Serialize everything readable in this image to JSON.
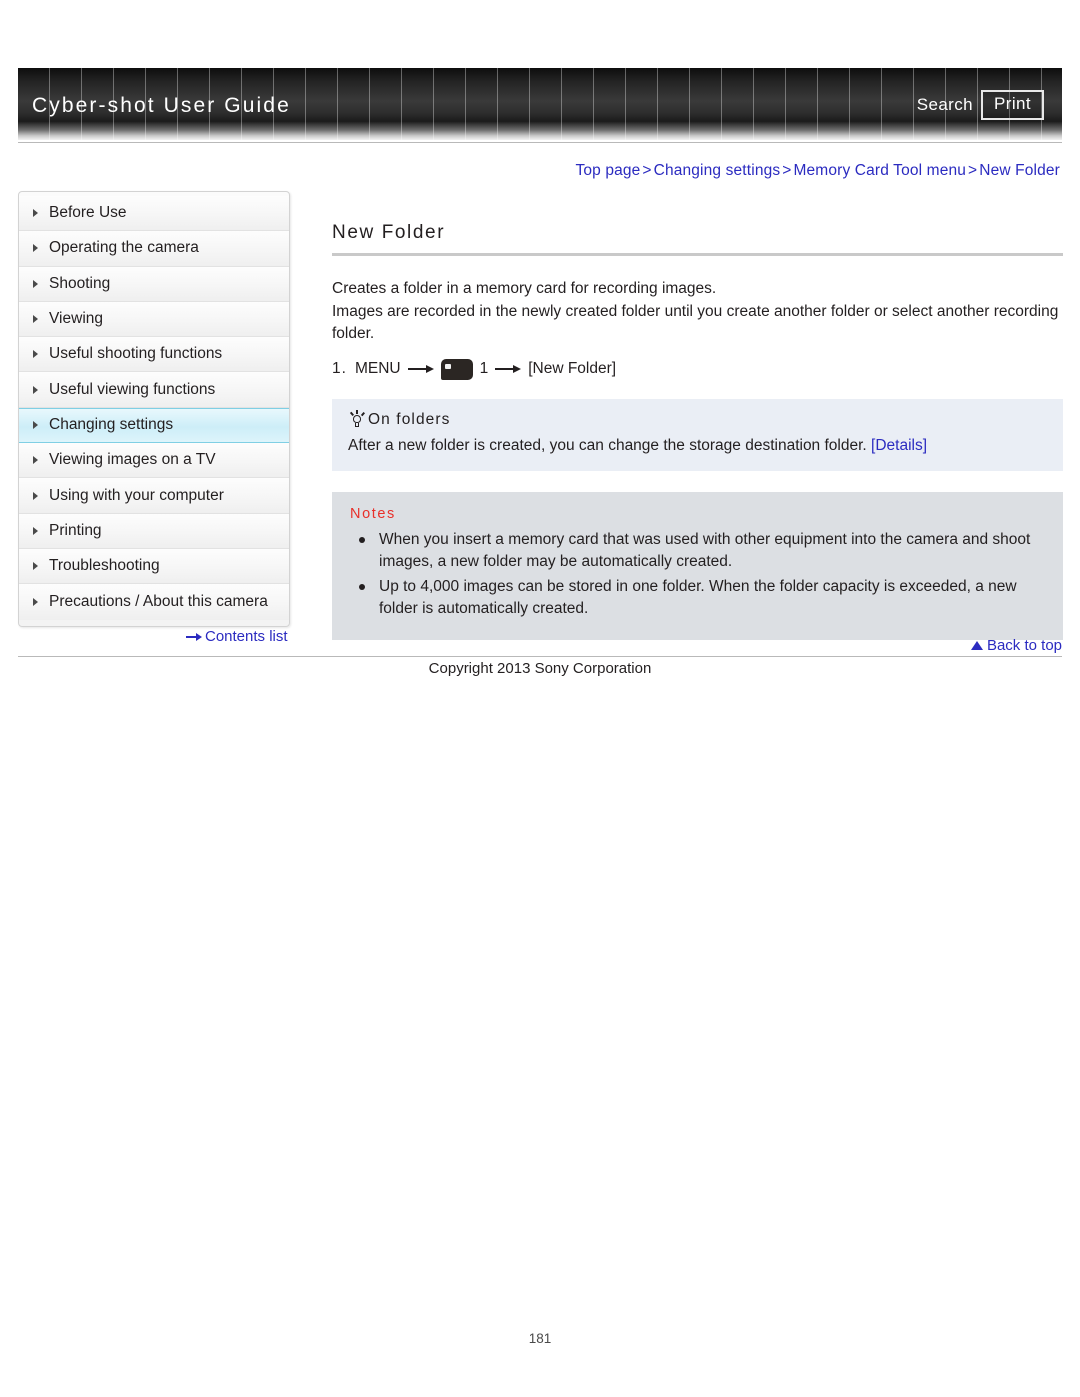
{
  "header": {
    "site_title": "Cyber-shot User Guide",
    "search_label": "Search",
    "print_label": "Print"
  },
  "breadcrumb": {
    "items": [
      "Top page",
      "Changing settings",
      "Memory Card Tool menu",
      "New Folder"
    ],
    "separator": ">"
  },
  "sidebar": {
    "items": [
      {
        "label": "Before Use",
        "active": false
      },
      {
        "label": "Operating the camera",
        "active": false
      },
      {
        "label": "Shooting",
        "active": false
      },
      {
        "label": "Viewing",
        "active": false
      },
      {
        "label": "Useful shooting functions",
        "active": false
      },
      {
        "label": "Useful viewing functions",
        "active": false
      },
      {
        "label": "Changing settings",
        "active": true
      },
      {
        "label": "Viewing images on a TV",
        "active": false
      },
      {
        "label": "Using with your computer",
        "active": false
      },
      {
        "label": "Printing",
        "active": false
      },
      {
        "label": "Troubleshooting",
        "active": false
      },
      {
        "label": "Precautions / About this camera",
        "active": false
      }
    ],
    "contents_list_label": "Contents list"
  },
  "main": {
    "title": "New Folder",
    "paragraph_1": "Creates a folder in a memory card for recording images.",
    "paragraph_2": "Images are recorded in the newly created folder until you create another folder or select another recording folder.",
    "step": {
      "number": "1.",
      "menu_label": "MENU",
      "icon_name": "memory-card-tool-icon",
      "menu_index": "1",
      "target": "[New Folder]"
    },
    "tip": {
      "heading": "On folders",
      "text": "After a new folder is created, you can change the storage destination folder.",
      "link_label": "[Details]"
    },
    "notes": {
      "heading": "Notes",
      "items": [
        "When you insert a memory card that was used with other equipment into the camera and shoot images, a new folder may be automatically created.",
        "Up to 4,000 images can be stored in one folder. When the folder capacity is exceeded, a new folder is automatically created."
      ]
    }
  },
  "footer": {
    "back_to_top_label": "Back to top",
    "copyright": "Copyright 2013 Sony Corporation",
    "page_number": "181"
  },
  "colors": {
    "link": "#2b2bc0",
    "notes_heading": "#e8302a",
    "active_nav": "#cdeef8",
    "tip_box_bg": "#eaeef5",
    "notes_box_bg": "#dcdfe3"
  }
}
